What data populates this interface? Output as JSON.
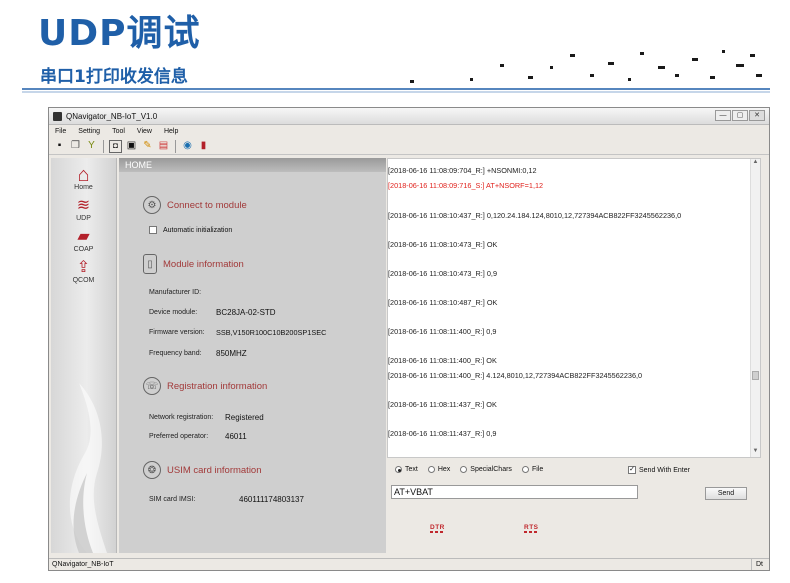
{
  "slide": {
    "title": "UDP调试",
    "subtitle": "串口1打印收发信息"
  },
  "window": {
    "title": "QNavigator_NB-IoT_V1.0",
    "controls": [
      "—",
      "▢",
      "✕"
    ]
  },
  "menu": [
    "File",
    "Setting",
    "Tool",
    "View",
    "Help"
  ],
  "toolbar_icons": [
    "save-icon",
    "copy-icon",
    "filter-icon",
    "open-icon",
    "stop-icon",
    "clear-icon",
    "document-icon",
    "globe-icon",
    "book-icon"
  ],
  "sidebar": {
    "items": [
      {
        "label": "Home",
        "icon": "home-icon",
        "glyph": "⌂"
      },
      {
        "label": "UDP",
        "icon": "wifi-icon",
        "glyph": "≋"
      },
      {
        "label": "COAP",
        "icon": "chat-icon",
        "glyph": "▰"
      },
      {
        "label": "QCOM",
        "icon": "upload-icon",
        "glyph": "⇪"
      }
    ]
  },
  "home": {
    "header": "HOME",
    "connect": {
      "title": "Connect to module",
      "auto_init": "Automatic initialization"
    },
    "module": {
      "title": "Module information",
      "manufacturer_label": "Manufacturer ID:",
      "manufacturer_value": "",
      "device_label": "Device module:",
      "device_value": "BC28JA-02-STD",
      "firmware_label": "Firmware version:",
      "firmware_value": "SSB,V150R100C10B200SP1SEC",
      "band_label": "Frequency band:",
      "band_value": "850MHZ"
    },
    "registration": {
      "title": "Registration information",
      "network_label": "Network registration:",
      "network_value": "Registered",
      "operator_label": "Preferred operator:",
      "operator_value": "46011"
    },
    "usim": {
      "title": "USIM card information",
      "imsi_label": "SIM card IMSI:",
      "imsi_value": "460111174803137"
    }
  },
  "log": [
    {
      "text": "[2018-06-16 11:08:09:704_R:] +NSONMI:0,12",
      "color": "#222222"
    },
    {
      "text": "[2018-06-16 11:08:09:716_S:] AT+NSORF=1,12",
      "color": "#e0221d"
    },
    {
      "text": "[2018-06-16 11:08:10:437_R:] 0,120.24.184.124,8010,12,727394ACB822FF3245562236,0",
      "color": "#222222"
    },
    {
      "text": "[2018-06-16 11:08:10:473_R:] OK",
      "color": "#222222"
    },
    {
      "text": "[2018-06-16 11:08:10:473_R:] 0,9",
      "color": "#222222"
    },
    {
      "text": "[2018-06-16 11:08:10:487_R:] OK",
      "color": "#222222"
    },
    {
      "text": "[2018-06-16 11:08:11:400_R:] 0,9",
      "color": "#222222"
    },
    {
      "text": "[2018-06-16 11:08:11:400_R:] OK",
      "color": "#222222"
    },
    {
      "text": "[2018-06-16 11:08:11:400_R:] 4.124,8010,12,727394ACB822FF3245562236,0",
      "color": "#222222"
    },
    {
      "text": "[2018-06-16 11:08:11:437_R:] OK",
      "color": "#222222"
    },
    {
      "text": "[2018-06-16 11:08:11:437_R:] 0,9",
      "color": "#222222"
    }
  ],
  "send": {
    "modes": [
      "Text",
      "Hex",
      "SpecialChars",
      "File"
    ],
    "selected_mode": "Text",
    "send_with_enter": "Send With Enter",
    "send_with_enter_checked": true,
    "input_value": "AT+VBAT",
    "send_button": "Send",
    "signal_dtr": "DTR",
    "signal_rts": "RTS"
  },
  "status": {
    "left": "QNavigator_NB-IoT",
    "right": "Dt"
  },
  "colors": {
    "title_blue": "#1f5fa8",
    "section_red": "#a23a3a",
    "log_sent_red": "#e0221d"
  }
}
